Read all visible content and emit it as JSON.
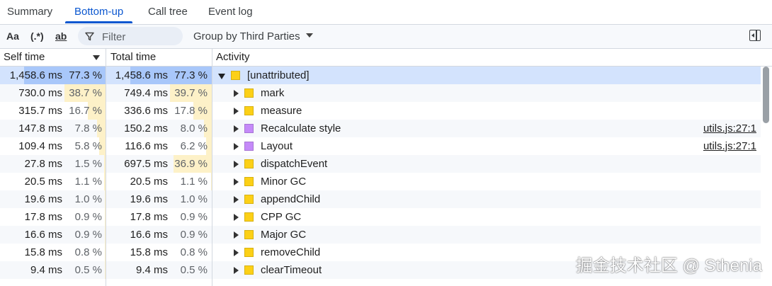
{
  "tabs": [
    {
      "label": "Summary",
      "active": false
    },
    {
      "label": "Bottom-up",
      "active": true
    },
    {
      "label": "Call tree",
      "active": false
    },
    {
      "label": "Event log",
      "active": false
    }
  ],
  "toolbar": {
    "match_case": "Aa",
    "regex": "(.*)",
    "whole_word": "ab",
    "filter_placeholder": "Filter",
    "group_by": "Group by Third Parties"
  },
  "header": {
    "self_time": "Self time",
    "total_time": "Total time",
    "activity": "Activity"
  },
  "colors": {
    "accent": "#0b57d0",
    "selected_row": "#d3e3fd",
    "bar_fill": "#fdf1c8",
    "scripting": "#fcd016",
    "rendering": "#c58af9"
  },
  "rows": [
    {
      "self_ms": "1,458.6 ms",
      "self_pct": "77.3 %",
      "self_frac": 0.773,
      "total_ms": "1,458.6 ms",
      "total_pct": "77.3 %",
      "total_frac": 0.773,
      "name": "[unattributed]",
      "color": "#fcd016",
      "expanded": true,
      "selected": true,
      "link": ""
    },
    {
      "self_ms": "730.0 ms",
      "self_pct": "38.7 %",
      "self_frac": 0.387,
      "total_ms": "749.4 ms",
      "total_pct": "39.7 %",
      "total_frac": 0.397,
      "name": "mark",
      "color": "#fcd016",
      "expanded": false,
      "selected": false,
      "link": ""
    },
    {
      "self_ms": "315.7 ms",
      "self_pct": "16.7 %",
      "self_frac": 0.167,
      "total_ms": "336.6 ms",
      "total_pct": "17.8 %",
      "total_frac": 0.178,
      "name": "measure",
      "color": "#fcd016",
      "expanded": false,
      "selected": false,
      "link": ""
    },
    {
      "self_ms": "147.8 ms",
      "self_pct": "7.8 %",
      "self_frac": 0.078,
      "total_ms": "150.2 ms",
      "total_pct": "8.0 %",
      "total_frac": 0.08,
      "name": "Recalculate style",
      "color": "#c58af9",
      "expanded": false,
      "selected": false,
      "link": "utils.js:27:1"
    },
    {
      "self_ms": "109.4 ms",
      "self_pct": "5.8 %",
      "self_frac": 0.058,
      "total_ms": "116.6 ms",
      "total_pct": "6.2 %",
      "total_frac": 0.062,
      "name": "Layout",
      "color": "#c58af9",
      "expanded": false,
      "selected": false,
      "link": "utils.js:27:1"
    },
    {
      "self_ms": "27.8 ms",
      "self_pct": "1.5 %",
      "self_frac": 0.015,
      "total_ms": "697.5 ms",
      "total_pct": "36.9 %",
      "total_frac": 0.369,
      "name": "dispatchEvent",
      "color": "#fcd016",
      "expanded": false,
      "selected": false,
      "link": ""
    },
    {
      "self_ms": "20.5 ms",
      "self_pct": "1.1 %",
      "self_frac": 0.011,
      "total_ms": "20.5 ms",
      "total_pct": "1.1 %",
      "total_frac": 0.011,
      "name": "Minor GC",
      "color": "#fcd016",
      "expanded": false,
      "selected": false,
      "link": ""
    },
    {
      "self_ms": "19.6 ms",
      "self_pct": "1.0 %",
      "self_frac": 0.01,
      "total_ms": "19.6 ms",
      "total_pct": "1.0 %",
      "total_frac": 0.01,
      "name": "appendChild",
      "color": "#fcd016",
      "expanded": false,
      "selected": false,
      "link": ""
    },
    {
      "self_ms": "17.8 ms",
      "self_pct": "0.9 %",
      "self_frac": 0.009,
      "total_ms": "17.8 ms",
      "total_pct": "0.9 %",
      "total_frac": 0.009,
      "name": "CPP GC",
      "color": "#fcd016",
      "expanded": false,
      "selected": false,
      "link": ""
    },
    {
      "self_ms": "16.6 ms",
      "self_pct": "0.9 %",
      "self_frac": 0.009,
      "total_ms": "16.6 ms",
      "total_pct": "0.9 %",
      "total_frac": 0.009,
      "name": "Major GC",
      "color": "#fcd016",
      "expanded": false,
      "selected": false,
      "link": ""
    },
    {
      "self_ms": "15.8 ms",
      "self_pct": "0.8 %",
      "self_frac": 0.008,
      "total_ms": "15.8 ms",
      "total_pct": "0.8 %",
      "total_frac": 0.008,
      "name": "removeChild",
      "color": "#fcd016",
      "expanded": false,
      "selected": false,
      "link": ""
    },
    {
      "self_ms": "9.4 ms",
      "self_pct": "0.5 %",
      "self_frac": 0.005,
      "total_ms": "9.4 ms",
      "total_pct": "0.5 %",
      "total_frac": 0.005,
      "name": "clearTimeout",
      "color": "#fcd016",
      "expanded": false,
      "selected": false,
      "link": ""
    }
  ],
  "watermark": "掘金技术社区 @ Sthenia"
}
